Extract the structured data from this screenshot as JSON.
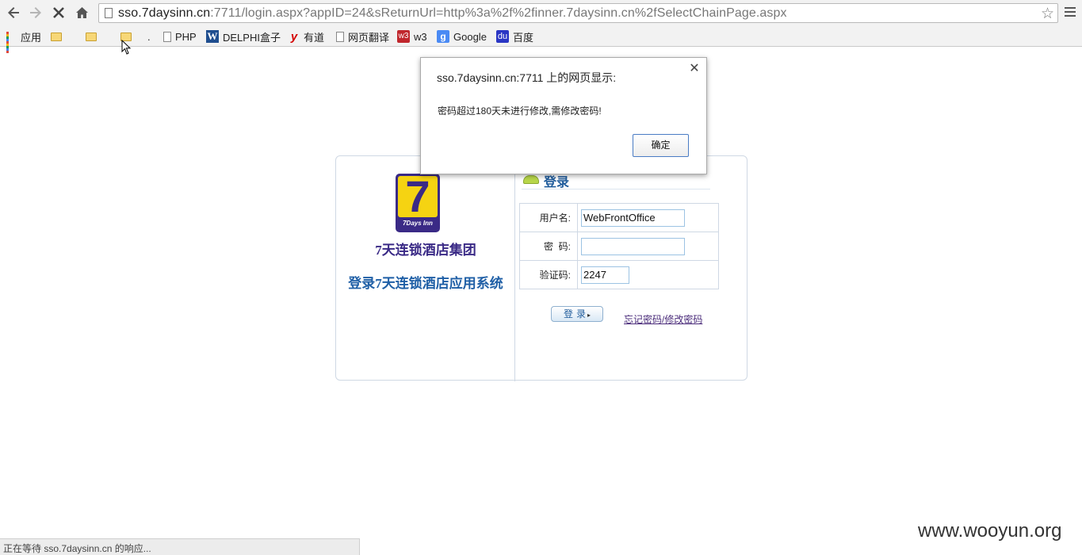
{
  "browser": {
    "url_host": "sso.7daysinn.cn",
    "url_rest": ":7711/login.aspx?appID=24&sReturnUrl=http%3a%2f%2finner.7daysinn.cn%2fSelectChainPage.aspx",
    "icons": {
      "back": "back-arrow-icon",
      "forward": "forward-arrow-icon",
      "stop": "stop-icon",
      "home": "home-icon",
      "star": "star-icon",
      "menu": "hamburger-menu-icon"
    },
    "bookmarks": [
      {
        "label": "应用",
        "icon": "apps-grid-icon"
      },
      {
        "label": "",
        "icon": "folder-icon"
      },
      {
        "label": "",
        "icon": "folder-icon"
      },
      {
        "label": "",
        "icon": "folder-icon"
      },
      {
        "label": ".",
        "icon": ""
      },
      {
        "label": "PHP",
        "icon": "page-icon"
      },
      {
        "label": "DELPHI盒子",
        "icon": "w-icon"
      },
      {
        "label": "有道",
        "icon": "youdao-icon"
      },
      {
        "label": "网页翻译",
        "icon": "page-icon"
      },
      {
        "label": "w3",
        "icon": "w3-icon"
      },
      {
        "label": "Google",
        "icon": "google-icon"
      },
      {
        "label": "百度",
        "icon": "baidu-icon"
      }
    ]
  },
  "login": {
    "logo_digit": "7",
    "logo_caption": "7Days Inn",
    "company_name": "7天连锁酒店集团",
    "system_name": "登录7天连锁酒店应用系统",
    "title": "登录",
    "fields": {
      "username_label": "用户名:",
      "username_value": "WebFrontOffice",
      "password_label": "密  码:",
      "password_value": "",
      "captcha_label": "验证码:",
      "captcha_value": "2247"
    },
    "login_button": "登录",
    "forgot_link": "忘记密码/修改密码"
  },
  "alert": {
    "title": "sso.7daysinn.cn:7711 上的网页显示:",
    "message": "密码超过180天未进行修改,需修改密码!",
    "ok_button": "确定",
    "close_icon": "close-icon"
  },
  "status_bar": {
    "text": "正在等待 sso.7daysinn.cn 的响应..."
  },
  "watermark": {
    "text": "www.wooyun.org"
  }
}
